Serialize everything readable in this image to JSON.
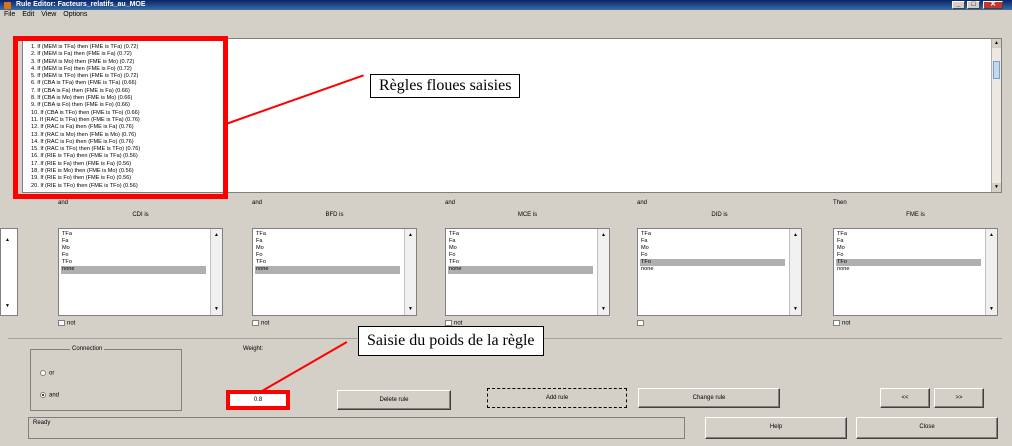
{
  "window": {
    "title": "Rule Editor: Facteurs_relatifs_au_MOE"
  },
  "menu": [
    "File",
    "Edit",
    "View",
    "Options"
  ],
  "rules": [
    "1. If (MEM is TFa) then (FME is TFa) (0.72)",
    "2. If (MEM is Fa) then (FME is Fa) (0.72)",
    "3. If (MEM is Mo) then (FME is Mo) (0.72)",
    "4. If (MEM is Fo) then (FME is Fo) (0.72)",
    "5. If (MEM is TFo) then (FME is TFo) (0.72)",
    "6. If (CBA is TFa) then (FME is TFa) (0.66)",
    "7. If (CBA is Fa) then (FME is Fa) (0.66)",
    "8. If (CBA is Mo) then (FME is Mo) (0.66)",
    "9. If (CBA is Fo) then (FME is Fo) (0.66)",
    "10. If (CBA is TFo) then (FME is TFo) (0.66)",
    "11. If (RAC is TFa) then (FME is TFa) (0.76)",
    "12. If (RAC is Fa) then (FME is Fa) (0.76)",
    "13. If (RAC is Mo) then (FME is Mo) (0.76)",
    "14. If (RAC is Fo) then (FME is Fo) (0.76)",
    "15. If (RAC is TFo) then (FME is TFo) (0.76)",
    "16. If (RIE is TFa) then (FME is TFa) (0.56)",
    "17. If (RIE is Fa) then (FME is Fa) (0.56)",
    "18. If (RIE is Mo) then (FME is Mo) (0.56)",
    "19. If (RIE is Fo) then (FME is Fo) (0.56)",
    "20. If (RIE is TFo) then (FME is TFo) (0.56)"
  ],
  "annotations": {
    "rules_callout": "Règles floues saisies",
    "weight_callout": "Saisie du poids de la règle"
  },
  "columns": [
    {
      "conj": "and",
      "var": "CDI is",
      "items": [
        "TFa",
        "Fa",
        "Mo",
        "Fo",
        "TFo",
        "none"
      ],
      "selected": 5,
      "not": "not"
    },
    {
      "conj": "and",
      "var": "BFD is",
      "items": [
        "TFa",
        "Fa",
        "Mo",
        "Fo",
        "TFo",
        "none"
      ],
      "selected": 5,
      "not": "not"
    },
    {
      "conj": "and",
      "var": "MCE is",
      "items": [
        "TFa",
        "Fa",
        "Mo",
        "Fo",
        "TFo",
        "none"
      ],
      "selected": 5,
      "not": "not"
    },
    {
      "conj": "and",
      "var": "DID is",
      "items": [
        "TFa",
        "Fa",
        "Mo",
        "Fo",
        "TFo",
        "none"
      ],
      "selected": 4,
      "not": ""
    },
    {
      "conj": "Then",
      "var": "FME is",
      "items": [
        "TFa",
        "Fa",
        "Mo",
        "Fo",
        "TFo",
        "none"
      ],
      "selected": 4,
      "not": "not"
    }
  ],
  "connection": {
    "label": "Connection",
    "options": [
      "or",
      "and"
    ],
    "selected": "and"
  },
  "weight": {
    "label": "Weight:",
    "value": "0.8"
  },
  "buttons": {
    "delete": "Delete rule",
    "add": "Add rule",
    "change": "Change rule",
    "prev": "<<",
    "next": ">>",
    "help": "Help",
    "close": "Close"
  },
  "status": "Ready",
  "colors": {
    "highlight": "#ff0000",
    "selection": "#b0b0b0",
    "window_bg": "#d4d0c8"
  }
}
